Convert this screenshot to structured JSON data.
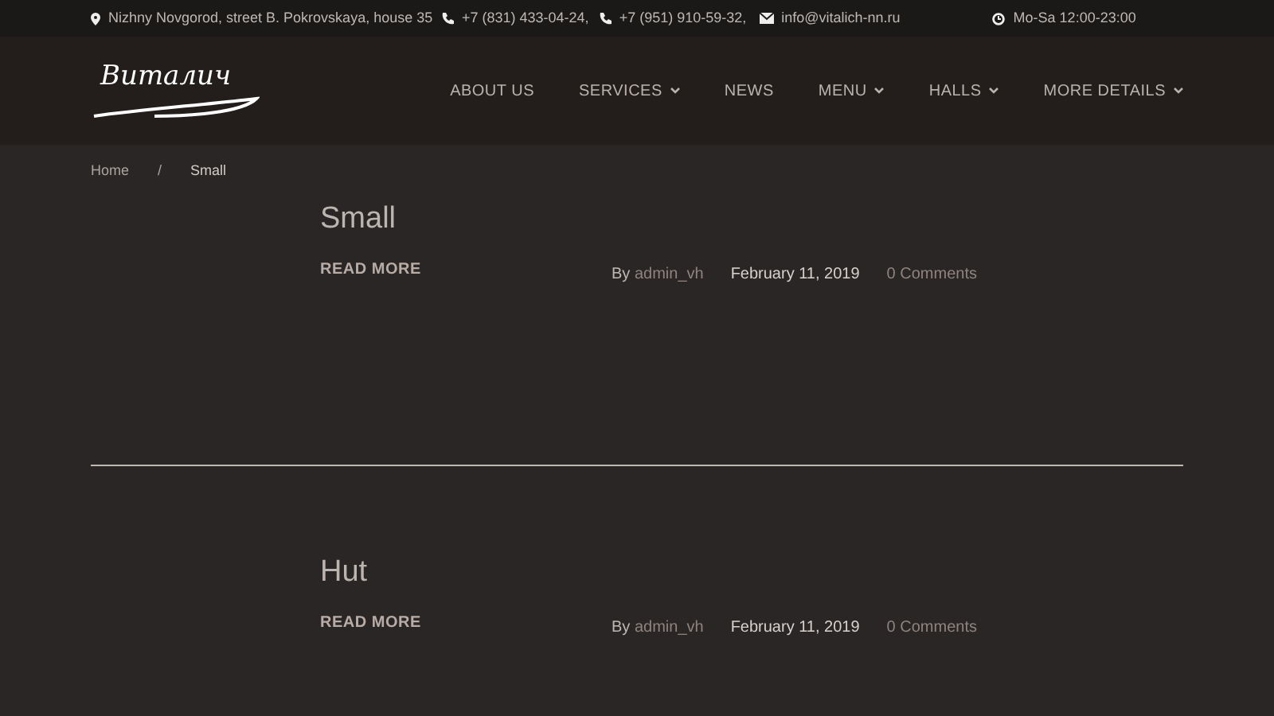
{
  "top_bar": {
    "address": "Nizhny Novgorod, street B. Pokrovskaya, house 35",
    "phones": [
      "+7 (831) 433-04-24,",
      "+7 (951) 910-59-32,"
    ],
    "email": "info@vitalich-nn.ru",
    "hours": "Mo-Sa 12:00-23:00"
  },
  "header": {
    "logo": "Виталич",
    "nav": [
      {
        "label": "ABOUT US",
        "dropdown": false
      },
      {
        "label": "SERVICES",
        "dropdown": true
      },
      {
        "label": "NEWS",
        "dropdown": false
      },
      {
        "label": "MENU",
        "dropdown": true
      },
      {
        "label": "HALLS",
        "dropdown": true
      },
      {
        "label": "MORE DETAILS",
        "dropdown": true
      }
    ]
  },
  "breadcrumb": {
    "items": [
      "Home",
      "Small"
    ],
    "separator": "/"
  },
  "posts": [
    {
      "title": "Small",
      "read_more": "READ MORE",
      "by": "By",
      "author": "admin_vh",
      "date": "February 11, 2019",
      "comments": "0 Comments"
    },
    {
      "title": "Hut",
      "read_more": "READ MORE",
      "by": "By",
      "author": "admin_vh",
      "date": "February 11, 2019",
      "comments": "0 Comments"
    }
  ]
}
